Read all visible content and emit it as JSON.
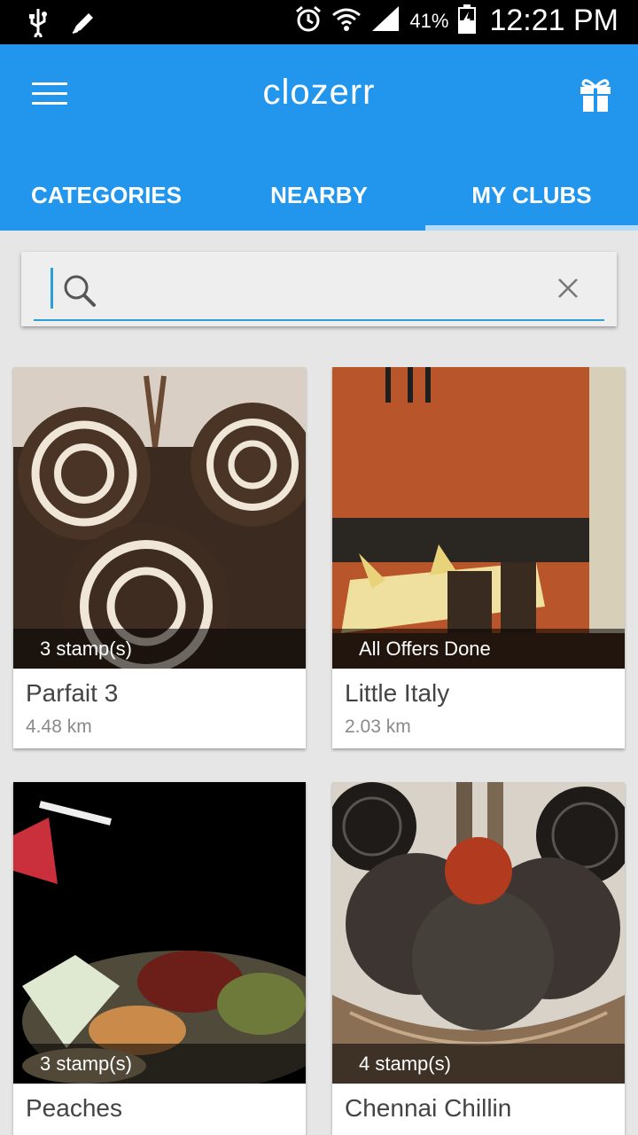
{
  "status_bar": {
    "battery_percent": "41%",
    "time": "12:21 PM",
    "icons": [
      "usb-icon",
      "edit-icon",
      "alarm-icon",
      "wifi-icon",
      "signal-icon",
      "battery-icon"
    ]
  },
  "app_bar": {
    "brand": "clozerr",
    "icons": [
      "menu-icon",
      "gift-icon"
    ]
  },
  "tabs": [
    {
      "label": "CATEGORIES",
      "active": false
    },
    {
      "label": "NEARBY",
      "active": false
    },
    {
      "label": "MY CLUBS",
      "active": true
    }
  ],
  "search": {
    "value": "",
    "icons": [
      "search-icon",
      "clear-icon"
    ]
  },
  "clubs": [
    {
      "name": "Parfait 3",
      "distance": "4.48 km",
      "badge": "3 stamp(s)"
    },
    {
      "name": "Little Italy",
      "distance": "2.03 km",
      "badge": "All Offers Done"
    },
    {
      "name": "Peaches",
      "distance": "",
      "badge": "3 stamp(s)"
    },
    {
      "name": "Chennai Chillin",
      "distance": "",
      "badge": "4 stamp(s)"
    }
  ],
  "colors": {
    "primary": "#2196ec",
    "tab_indicator": "#b3dcfb",
    "accent": "#2b9fd6"
  }
}
